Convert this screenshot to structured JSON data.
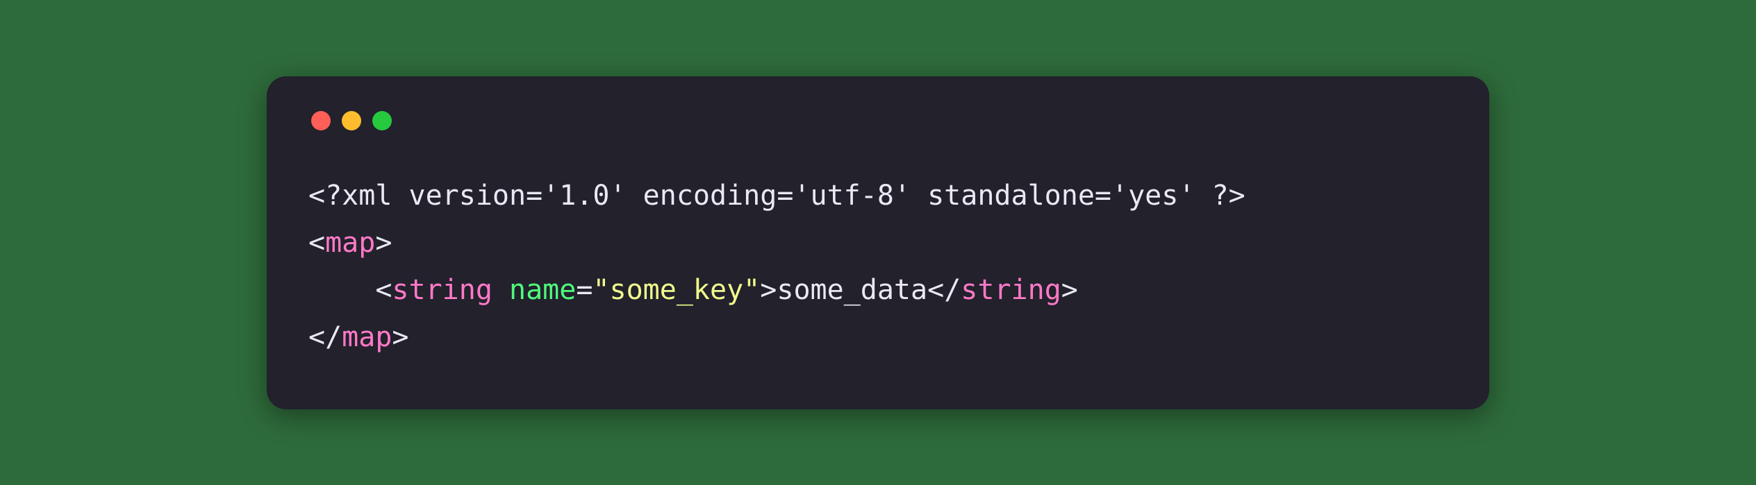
{
  "code": {
    "line1": {
      "open": "<?",
      "xml": "xml version",
      "eq1": "=",
      "v1": "'1.0'",
      "enc": " encoding",
      "eq2": "=",
      "v2": "'utf-8'",
      "sa": " standalone",
      "eq3": "=",
      "v3": "'yes'",
      "close": " ?>"
    },
    "line2": {
      "open": "<",
      "tag": "map",
      "close": ">"
    },
    "line3": {
      "indent": "    ",
      "open": "<",
      "tag": "string",
      "attr": " name",
      "eq": "=",
      "val": "\"some_key\"",
      "close": ">",
      "text": "some_data",
      "copen": "</",
      "ctag": "string",
      "cclose": ">"
    },
    "line4": {
      "open": "</",
      "tag": "map",
      "close": ">"
    }
  }
}
